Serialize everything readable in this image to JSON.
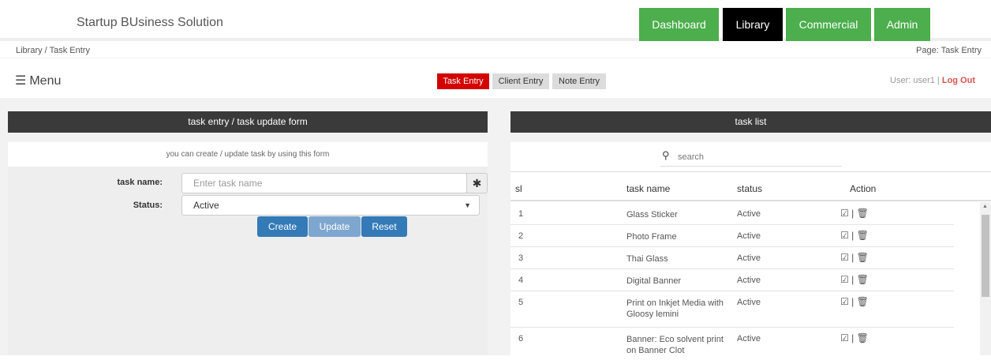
{
  "header": {
    "brand": "Startup BUsiness Solution",
    "nav": [
      {
        "label": "Dashboard"
      },
      {
        "label": "Library"
      },
      {
        "label": "Commercial"
      },
      {
        "label": "Admin"
      }
    ]
  },
  "breadcrumb": "Library / Task Entry",
  "page_label": "Page: Task Entry",
  "menu_label": "Menu",
  "subtabs": [
    {
      "label": "Task Entry"
    },
    {
      "label": "Client Entry"
    },
    {
      "label": "Note Entry"
    }
  ],
  "user": {
    "text": "User: user1 |",
    "logout": "Log Out"
  },
  "form": {
    "title": "task entry / task update form",
    "note": "you can create / update task by using this form",
    "task_name_label": "task name:",
    "task_name_placeholder": "Enter task name",
    "required_mark": "✱",
    "status_label": "Status:",
    "status_value": "Active",
    "buttons": {
      "create": "Create",
      "update": "Update",
      "reset": "Reset"
    }
  },
  "list": {
    "title": "task list",
    "search_placeholder": "search",
    "columns": {
      "sl": "sl",
      "name": "task name",
      "status": "status",
      "action": "Action"
    },
    "rows": [
      {
        "sl": "1",
        "name": "Glass Sticker",
        "status": "Active"
      },
      {
        "sl": "2",
        "name": "Photo Frame",
        "status": "Active"
      },
      {
        "sl": "3",
        "name": "Thai Glass",
        "status": "Active"
      },
      {
        "sl": "4",
        "name": "Digital Banner",
        "status": "Active"
      },
      {
        "sl": "5",
        "name": "Print on Inkjet Media with Gloosy lemini",
        "status": "Active"
      },
      {
        "sl": "6",
        "name": "Banner: Eco solvent print on Banner Clot",
        "status": "Active"
      }
    ],
    "action_separator": "|"
  },
  "icons": {
    "menu": "hamburger-icon",
    "search": "search-icon",
    "edit": "edit-icon",
    "delete": "trash-icon",
    "select": "chevron-down-icon"
  },
  "colors": {
    "nav_green": "#4cae4c",
    "nav_active": "#000000",
    "subtab_active": "#d40000",
    "panel_header": "#3a3a3a",
    "button_primary": "#337ab7",
    "logout": "#d9534f"
  }
}
